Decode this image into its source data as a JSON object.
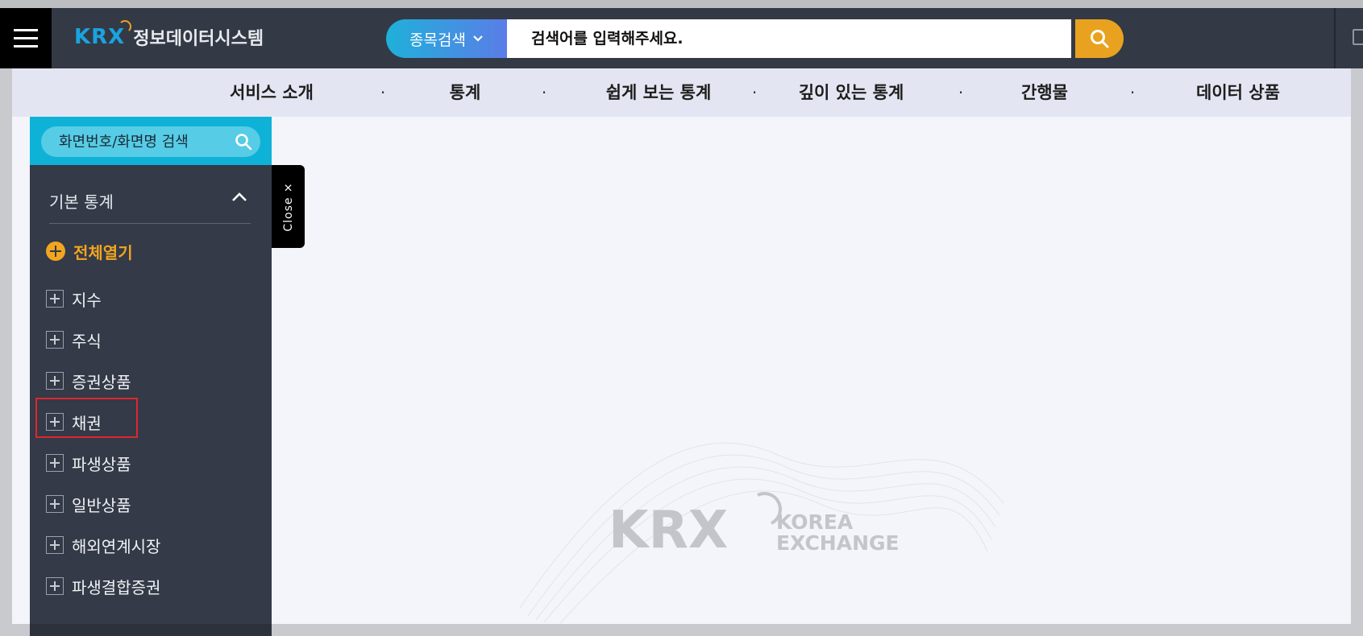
{
  "header": {
    "logo_mark": "KRX",
    "logo_text": "정보데이터시스템",
    "search": {
      "category": "종목검색",
      "placeholder": "검색어를 입력해주세요."
    }
  },
  "gnb": {
    "items": [
      "서비스 소개",
      "통계",
      "쉽게 보는 통계",
      "깊이 있는 통계",
      "간행물",
      "데이터 상품"
    ],
    "separator": "·"
  },
  "sidebar": {
    "search_placeholder": "화면번호/화면명 검색",
    "section_title": "기본 통계",
    "expand_all": "전체열기",
    "items": [
      "지수",
      "주식",
      "증권상품",
      "채권",
      "파생상품",
      "일반상품",
      "해외연계시장",
      "파생결합증권"
    ],
    "close_tab": "Close ×"
  },
  "watermark": {
    "mark": "KRX",
    "line1": "KOREA",
    "line2": "EXCHANGE"
  },
  "colors": {
    "header_bg": "#333a46",
    "accent_orange": "#e9a21f",
    "accent_cyan": "#0fb2d7",
    "sidebar_bg": "#343a47",
    "highlight_red": "#e0262f"
  }
}
